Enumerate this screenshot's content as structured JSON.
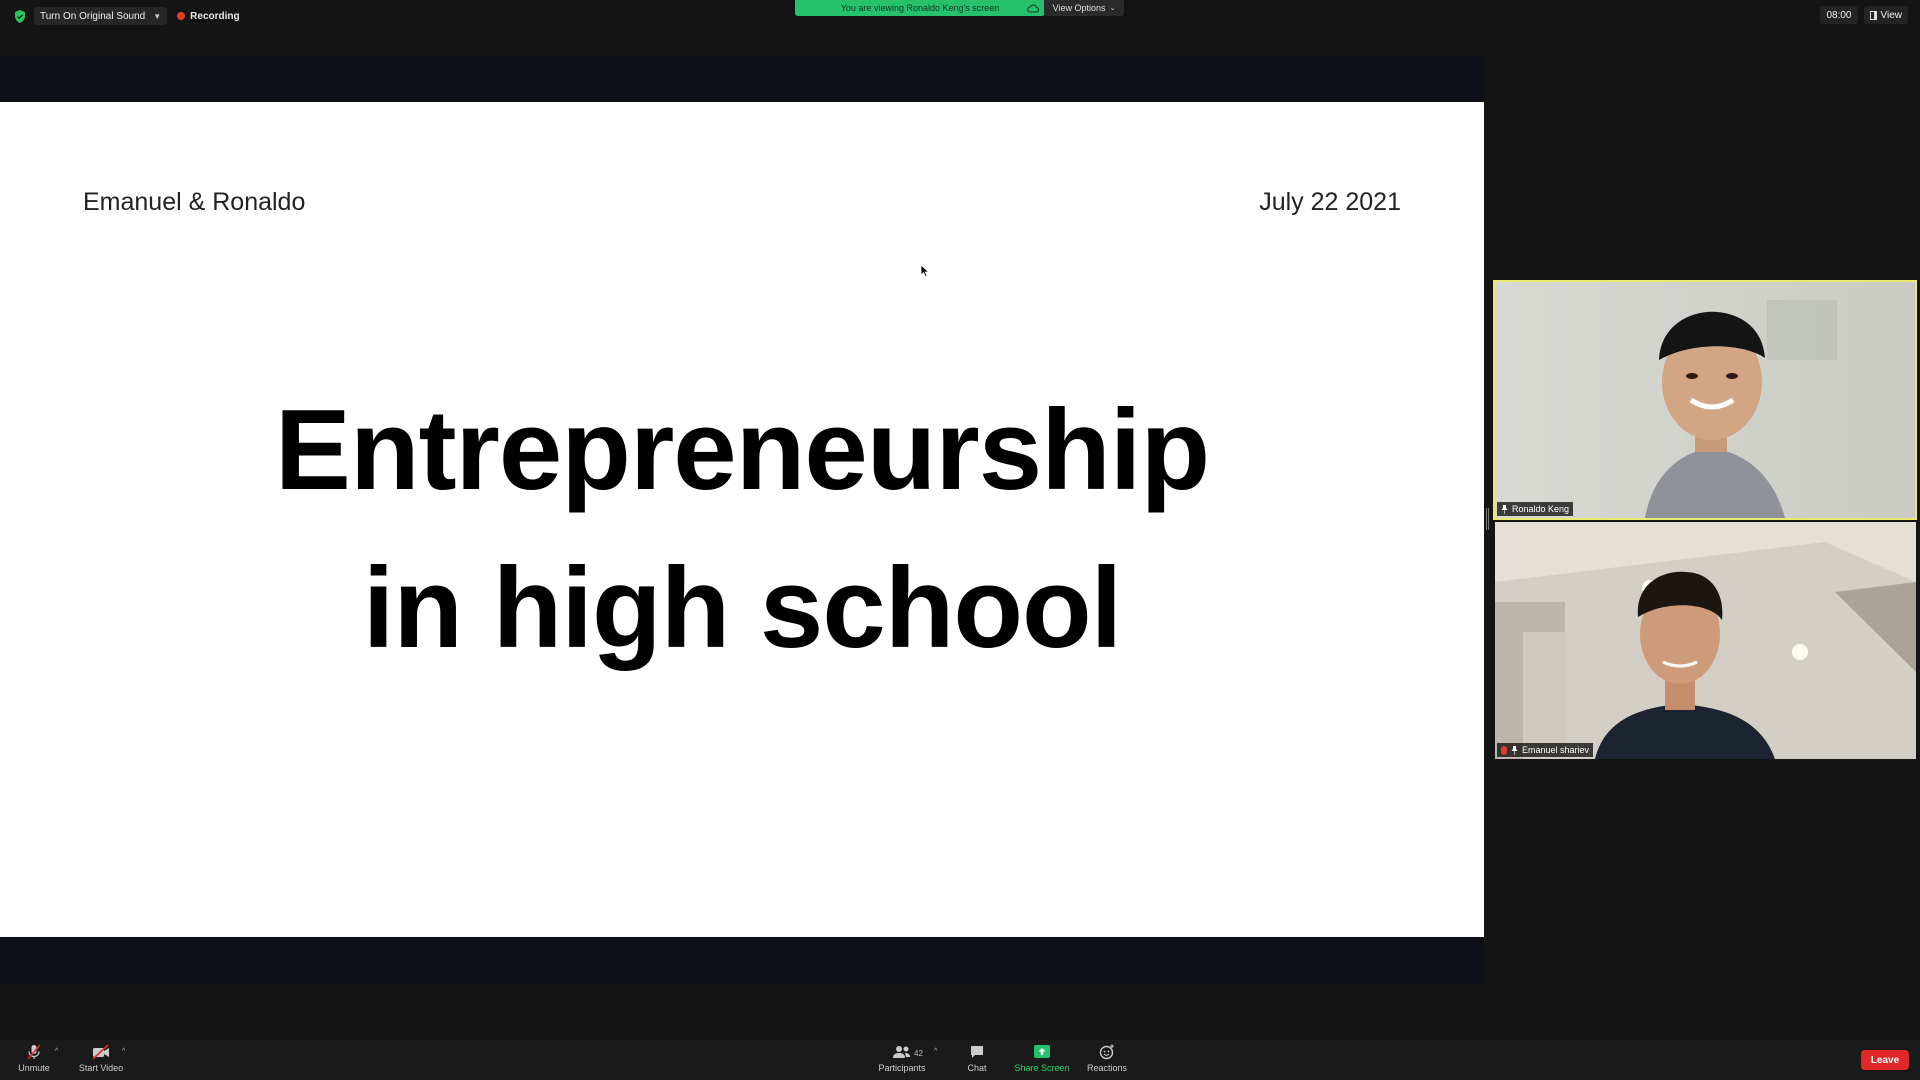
{
  "top_bar": {
    "original_sound_label": "Turn On Original Sound",
    "recording_label": "Recording",
    "share_banner_text": "You are viewing Ronaldo Keng's screen",
    "view_options_label": "View Options",
    "timer": "08:00",
    "view_label": "View"
  },
  "slide": {
    "authors": "Emanuel & Ronaldo",
    "date": "July 22 2021",
    "title_line_1": "Entrepreneurship",
    "title_line_2": "in high school"
  },
  "participants": [
    {
      "name": "Ronaldo Keng",
      "active_speaker": true
    },
    {
      "name": "Emanuel shariev",
      "active_speaker": false,
      "muted": true
    }
  ],
  "toolbar": {
    "unmute_label": "Unmute",
    "start_video_label": "Start Video",
    "participants_label": "Participants",
    "participants_count": "42",
    "chat_label": "Chat",
    "share_screen_label": "Share Screen",
    "reactions_label": "Reactions",
    "leave_label": "Leave"
  },
  "colors": {
    "share_green": "#25c26b",
    "active_speaker_border": "#e7ea6a",
    "leave_red": "#e02828",
    "recording_red": "#e8392f"
  },
  "icons": [
    "shield-icon",
    "caret-down-icon",
    "record-dot-icon",
    "cloud-icon",
    "chevron-down-icon",
    "view-icon",
    "pin-icon",
    "mic-off-icon",
    "video-off-icon",
    "participants-icon",
    "chat-icon",
    "share-screen-icon",
    "reactions-icon",
    "cursor-icon"
  ]
}
